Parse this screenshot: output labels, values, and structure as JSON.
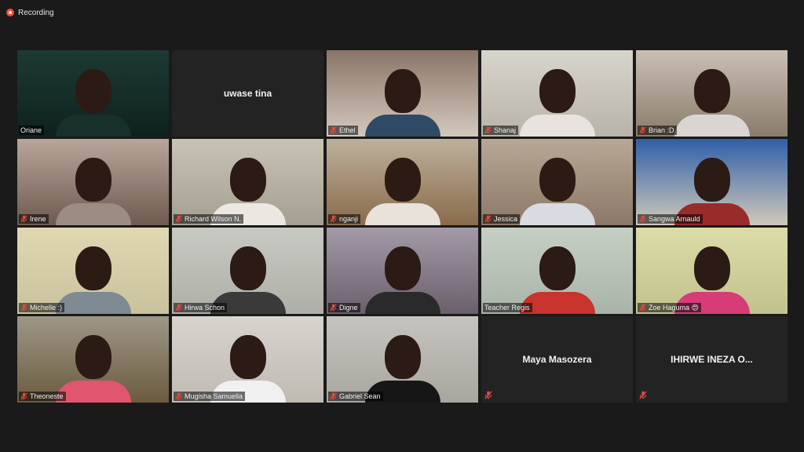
{
  "recording_label": "Recording",
  "participants": [
    {
      "name": "Oriane",
      "video": true,
      "bg": "#1d3a34",
      "bg2": "#0f211d",
      "shirt": "#173029"
    },
    {
      "name": "uwase tina",
      "video": false
    },
    {
      "name": "Ethel",
      "video": true,
      "bg": "#8a7568",
      "bg2": "#d4c8bd",
      "shirt": "#2f4a66"
    },
    {
      "name": "Shanaj",
      "video": true,
      "bg": "#d8d5cc",
      "bg2": "#b9b3a8",
      "shirt": "#e8e3de"
    },
    {
      "name": "Brian :D",
      "video": true,
      "bg": "#c9c0b4",
      "bg2": "#8a7c6c",
      "shirt": "#d9d6d2"
    },
    {
      "name": "Irene",
      "video": true,
      "bg": "#b9a59a",
      "bg2": "#6e5a4e",
      "shirt": "#9b8d82"
    },
    {
      "name": "Richard Wilson N.",
      "video": true,
      "bg": "#c8c3b4",
      "bg2": "#a59f90",
      "shirt": "#ece7e0"
    },
    {
      "name": "nganji",
      "video": true,
      "bg": "#bdb19c",
      "bg2": "#8a6b4b",
      "shirt": "#e8e2da"
    },
    {
      "name": "Jessica",
      "video": true,
      "bg": "#b8a896",
      "bg2": "#8c7868",
      "shirt": "#d9dbe2"
    },
    {
      "name": "Sangwa Arnauld",
      "video": true,
      "bg": "#2f5fa8",
      "bg2": "#d0c9ba",
      "shirt": "#9a2b2b"
    },
    {
      "name": "Michelle :)",
      "video": true,
      "bg": "#dfd8b2",
      "bg2": "#c9c29c",
      "shirt": "#7f8a92"
    },
    {
      "name": "Hirwa Schon",
      "video": true,
      "bg": "#c8c9c2",
      "bg2": "#aeb0a8",
      "shirt": "#3a3a3a"
    },
    {
      "name": "Digne",
      "video": true,
      "bg": "#a39aa8",
      "bg2": "#6b5f6c",
      "shirt": "#2a2a2a"
    },
    {
      "name": "Teacher Regis",
      "video": true,
      "bg": "#c6cfc4",
      "bg2": "#a9b4a8",
      "shirt": "#c8332d"
    },
    {
      "name": "Zoe Haguma 😍",
      "video": true,
      "bg": "#dcdca8",
      "bg2": "#c3c28f",
      "shirt": "#d63c78"
    },
    {
      "name": "Theoneste",
      "video": true,
      "bg": "#9d9788",
      "bg2": "#6c5b3e",
      "shirt": "#e0566e"
    },
    {
      "name": "Mugisha Samuella",
      "video": true,
      "bg": "#d8d4ce",
      "bg2": "#bfbab2",
      "shirt": "#f0f0f0"
    },
    {
      "name": "Gabriel Sean",
      "video": true,
      "bg": "#c6c4bf",
      "bg2": "#a9a69f",
      "shirt": "#161616"
    },
    {
      "name": "Maya Masozera",
      "video": false
    },
    {
      "name": "IHIRWE INEZA O...",
      "video": false
    }
  ],
  "active_speaker": "Teacher Regis",
  "colors": {
    "muted_icon": "#e8483c",
    "active_border": "#e9f08a",
    "background": "#1a1a1a"
  }
}
